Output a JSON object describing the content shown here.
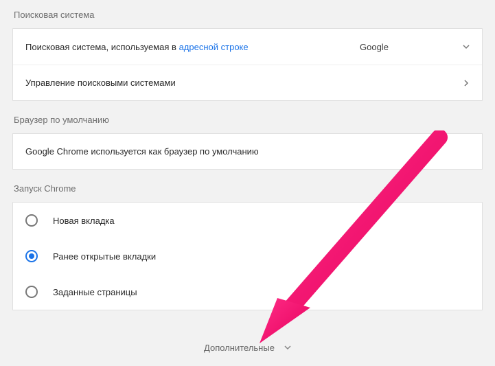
{
  "search_engine": {
    "section_title": "Поисковая система",
    "row1_prefix": "Поисковая система, используемая в ",
    "row1_link": "адресной строке",
    "selected_engine": "Google",
    "row2_label": "Управление поисковыми системами"
  },
  "default_browser": {
    "section_title": "Браузер по умолчанию",
    "message": "Google Chrome используется как браузер по умолчанию"
  },
  "on_startup": {
    "section_title": "Запуск Chrome",
    "options": [
      {
        "label": "Новая вкладка",
        "selected": false
      },
      {
        "label": "Ранее открытые вкладки",
        "selected": true
      },
      {
        "label": "Заданные страницы",
        "selected": false
      }
    ]
  },
  "footer": {
    "advanced_label": "Дополнительные"
  }
}
